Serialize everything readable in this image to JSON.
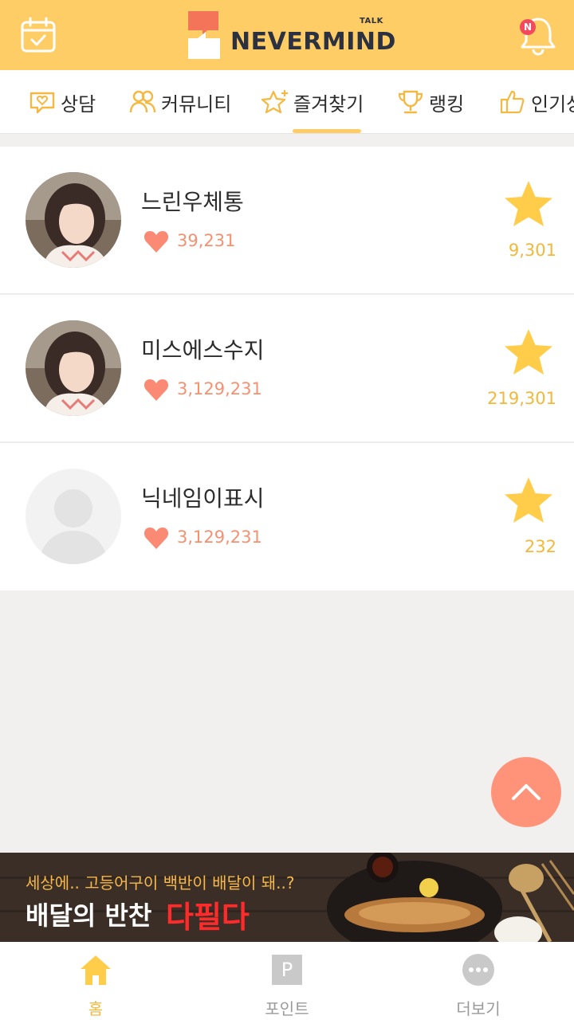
{
  "header": {
    "logo_text": "NEVERMIND",
    "logo_talk": "TALK",
    "notification_badge": "N",
    "colors": {
      "brand": "#ffcd66",
      "badge": "#f4485f"
    }
  },
  "tabs": [
    {
      "label": "상담",
      "icon": "chat-heart-icon"
    },
    {
      "label": "커뮤니티",
      "icon": "people-icon"
    },
    {
      "label": "즐겨찾기",
      "icon": "star-plus-icon",
      "active": true
    },
    {
      "label": "랭킹",
      "icon": "trophy-icon"
    },
    {
      "label": "인기상",
      "icon": "thumbs-up-icon"
    }
  ],
  "favorites": [
    {
      "name": "느린우체통",
      "likes": "39,231",
      "favorites": "9,301",
      "avatar": "photo"
    },
    {
      "name": "미스에스수지",
      "likes": "3,129,231",
      "favorites": "219,301",
      "avatar": "photo"
    },
    {
      "name": "닉네임이표시",
      "likes": "3,129,231",
      "favorites": "232",
      "avatar": "placeholder"
    }
  ],
  "banner": {
    "subtitle": "세상에.. 고등어구이 백반이 배달이 돼..?",
    "title": "배달의 반찬",
    "brand": "다필다"
  },
  "bottom_nav": [
    {
      "label": "홈",
      "icon": "home-icon",
      "active": true
    },
    {
      "label": "포인트",
      "icon": "points-icon",
      "glyph": "P"
    },
    {
      "label": "더보기",
      "icon": "more-icon"
    }
  ],
  "colors": {
    "heart": "#f59171",
    "star": "#ffcd4a",
    "scroll_top": "#ff9379",
    "active_nav": "#f5b840"
  }
}
